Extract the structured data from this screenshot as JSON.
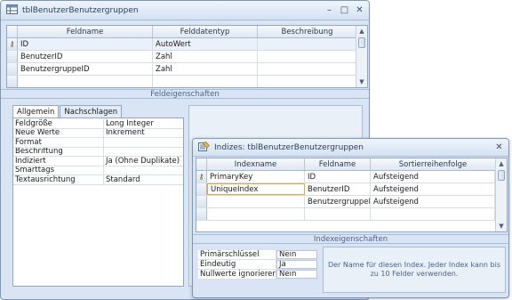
{
  "table_window": {
    "title": "tblBenutzerBenutzergruppen",
    "columns": [
      "Feldname",
      "Felddatentyp",
      "Beschreibung"
    ],
    "rows": [
      {
        "name": "ID",
        "type": "AutoWert",
        "desc": ""
      },
      {
        "name": "BenutzerID",
        "type": "Zahl",
        "desc": ""
      },
      {
        "name": "BenutzergruppeID",
        "type": "Zahl",
        "desc": ""
      }
    ],
    "section_label": "Feldeigenschaften",
    "tabs": [
      "Allgemein",
      "Nachschlagen"
    ],
    "properties": [
      {
        "key": "Feldgröße",
        "value": "Long Integer"
      },
      {
        "key": "Neue Werte",
        "value": "Inkrement"
      },
      {
        "key": "Format",
        "value": ""
      },
      {
        "key": "Beschriftung",
        "value": ""
      },
      {
        "key": "Indiziert",
        "value": "Ja (Ohne Duplikate)"
      },
      {
        "key": "Smarttags",
        "value": ""
      },
      {
        "key": "Textausrichtung",
        "value": "Standard"
      }
    ]
  },
  "index_window": {
    "title": "Indizes: tblBenutzerBenutzergruppen",
    "columns": [
      "Indexname",
      "Feldname",
      "Sortierreihenfolge"
    ],
    "rows": [
      {
        "index": "PrimaryKey",
        "field": "ID",
        "order": "Aufsteigend"
      },
      {
        "index": "UniqueIndex",
        "field": "BenutzerID",
        "order": "Aufsteigend"
      },
      {
        "index": "",
        "field": "BenutzergruppeID",
        "order": "Aufsteigend"
      }
    ],
    "section_label": "Indexeigenschaften",
    "properties": [
      {
        "key": "Primärschlüssel",
        "value": "Nein"
      },
      {
        "key": "Eindeutig",
        "value": "Ja"
      },
      {
        "key": "Nullwerte ignorieren",
        "value": "Nein"
      }
    ],
    "hint": "Der Name für diesen Index. Jeder Index kann bis zu 10 Felder verwenden."
  }
}
